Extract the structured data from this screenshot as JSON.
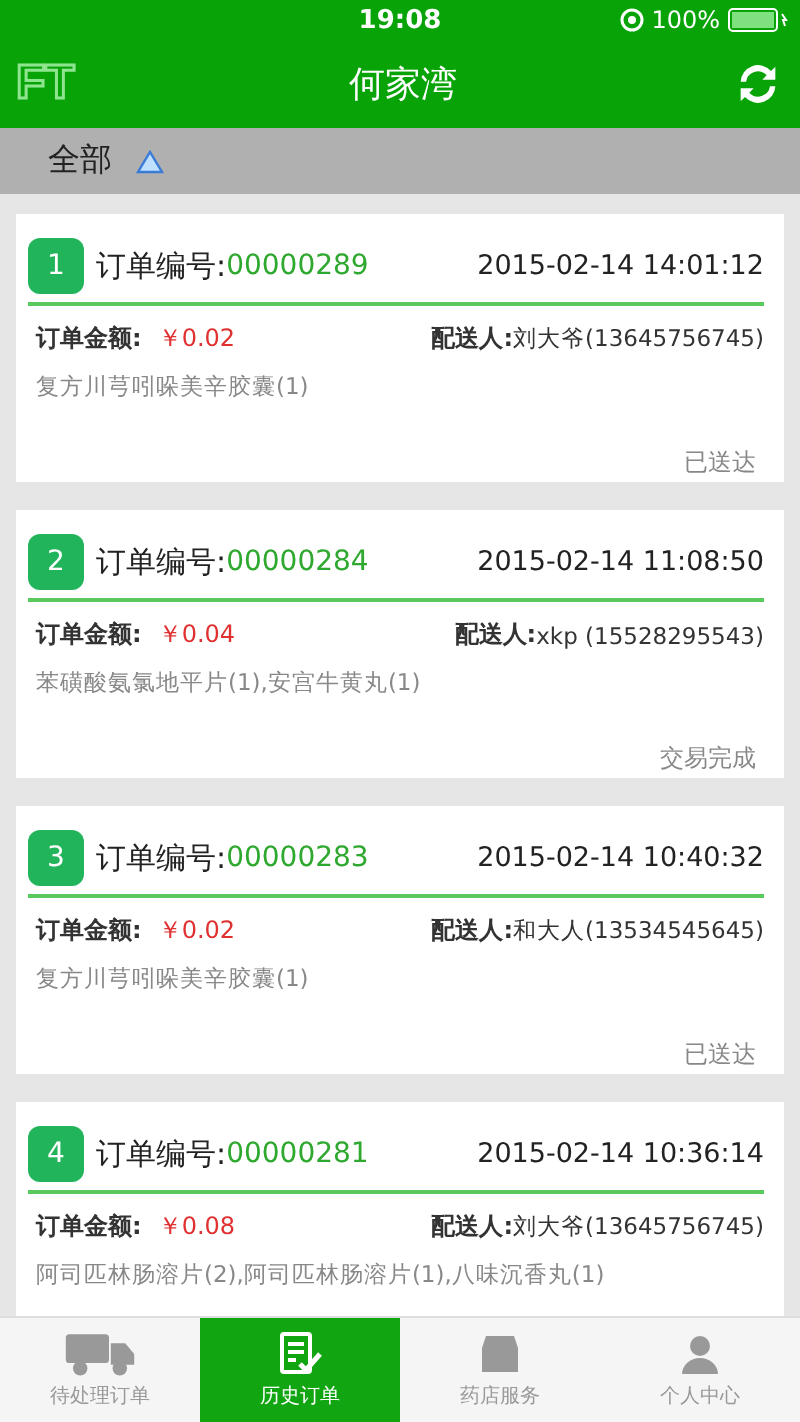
{
  "status_bar": {
    "time": "19:08",
    "battery": "100%"
  },
  "header": {
    "logo": "FT",
    "title": "何家湾"
  },
  "filter": {
    "label": "全部"
  },
  "orders": [
    {
      "index": "1",
      "number_label": "订单编号:",
      "number": "00000289",
      "time": "2015-02-14 14:01:12",
      "amount_label": "订单金额:",
      "amount": "￥0.02",
      "courier_label": "配送人:",
      "courier": "刘大爷(13645756745)",
      "items": "复方川芎吲哚美辛胶囊(1)",
      "status": "已送达"
    },
    {
      "index": "2",
      "number_label": "订单编号:",
      "number": "00000284",
      "time": "2015-02-14 11:08:50",
      "amount_label": "订单金额:",
      "amount": "￥0.04",
      "courier_label": "配送人:",
      "courier": "xkp  (15528295543)",
      "items": "苯磺酸氨氯地平片(1),安宫牛黄丸(1)",
      "status": "交易完成"
    },
    {
      "index": "3",
      "number_label": "订单编号:",
      "number": "00000283",
      "time": "2015-02-14 10:40:32",
      "amount_label": "订单金额:",
      "amount": "￥0.02",
      "courier_label": "配送人:",
      "courier": "和大人(13534545645)",
      "items": "复方川芎吲哚美辛胶囊(1)",
      "status": "已送达"
    },
    {
      "index": "4",
      "number_label": "订单编号:",
      "number": "00000281",
      "time": "2015-02-14 10:36:14",
      "amount_label": "订单金额:",
      "amount": "￥0.08",
      "courier_label": "配送人:",
      "courier": "刘大爷(13645756745)",
      "items": "阿司匹林肠溶片(2),阿司匹林肠溶片(1),八味沉香丸(1)"
    }
  ],
  "tabs": [
    {
      "label": "待处理订单",
      "kind": "truck",
      "selected": false
    },
    {
      "label": "历史订单",
      "kind": "doc",
      "selected": true
    },
    {
      "label": "药店服务",
      "kind": "store",
      "selected": false
    },
    {
      "label": "个人中心",
      "kind": "person",
      "selected": false
    }
  ]
}
